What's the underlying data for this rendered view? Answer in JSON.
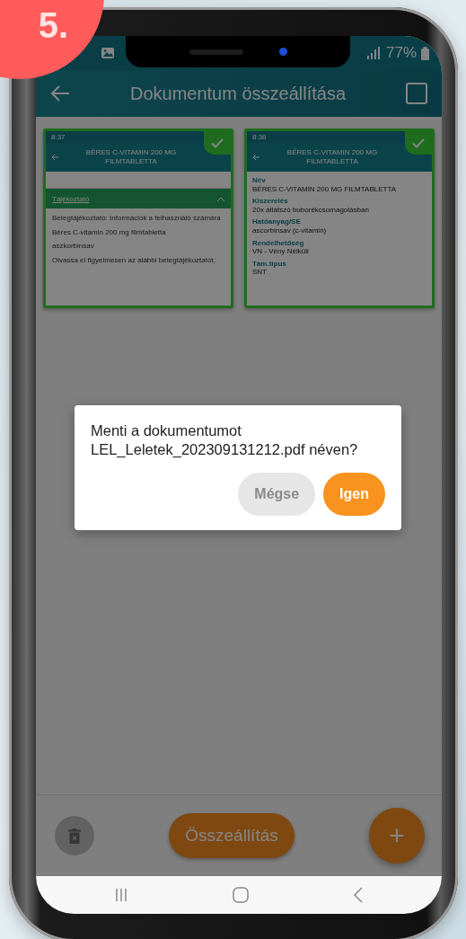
{
  "badge": "5.",
  "status_bar": {
    "battery": "77%"
  },
  "header": {
    "title": "Dokumentum összeállítása",
    "select_all": {
      "checked": false
    }
  },
  "pages": [
    {
      "selected": true,
      "kind": "leaflet",
      "time": "8:37",
      "title": "BÉRES C-VITAMIN 200 MG FILMTABLETTA",
      "section": "Tájékoztató",
      "lines": [
        "Betegtájékoztató: Információk a felhasználó számára",
        "Béres C-vitamin 200 mg filmtabletta",
        "aszkorbinsav",
        "Olvassa el figyelmesen az alábbi betegtájékoztatót,"
      ]
    },
    {
      "selected": true,
      "kind": "fields",
      "time": "8:36",
      "title": "BÉRES C-VITAMIN 200 MG FILMTABLETTA",
      "fields": [
        {
          "label": "Név",
          "value": "BÉRES C-VITAMIN 200 MG FILMTABLETTA"
        },
        {
          "label": "Kiszerelés",
          "value": "20x átlátszó buborékcsomagolásban"
        },
        {
          "label": "Hatóanyag/SE",
          "value": "ascorbinsav (c-vitamin)"
        },
        {
          "label": "Rendelhetőség",
          "value": "VN - Vény Nélküli"
        },
        {
          "label": "Tám.típus",
          "value": "SNT"
        }
      ]
    }
  ],
  "dialog": {
    "message": "Menti a dokumentumot LEL_Leletek_202309131212.pdf néven?",
    "buttons": [
      {
        "label": "Mégse",
        "kind": "secondary"
      },
      {
        "label": "Igen",
        "kind": "primary"
      }
    ]
  },
  "bottom": {
    "compose": "Összeállítás",
    "add": "+"
  }
}
